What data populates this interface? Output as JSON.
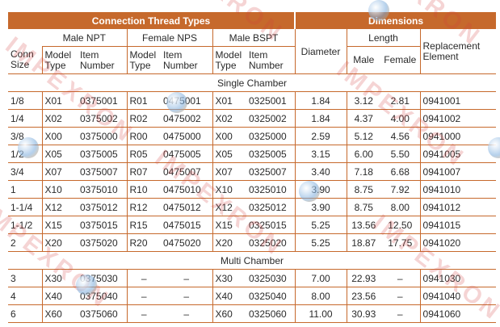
{
  "header": {
    "connection": "Connection Thread Types",
    "dimensions": "Dimensions"
  },
  "groups": {
    "male_npt": "Male NPT",
    "female_nps": "Female NPS",
    "male_bspt": "Male BSPT",
    "length": "Length"
  },
  "columns": {
    "conn_size": "Conn Size",
    "model_type": "Model Type",
    "item_number": "Item Number",
    "diameter": "Diameter",
    "male": "Male",
    "female": "Female",
    "replacement": "Replacement Element"
  },
  "sections": [
    {
      "title": "Single Chamber",
      "rows": [
        [
          "1/8",
          "X01",
          "0375001",
          "R01",
          "0475001",
          "X01",
          "0325001",
          "1.84",
          "3.12",
          "2.81",
          "0941001"
        ],
        [
          "1/4",
          "X02",
          "0375002",
          "R02",
          "0475002",
          "X02",
          "0325002",
          "1.84",
          "4.37",
          "4.00",
          "0941002"
        ],
        [
          "3/8",
          "X00",
          "0375000",
          "R00",
          "0475000",
          "X00",
          "0325000",
          "2.59",
          "5.12",
          "4.56",
          "0941000"
        ],
        [
          "1/2",
          "X05",
          "0375005",
          "R05",
          "0475005",
          "X05",
          "0325005",
          "3.15",
          "6.00",
          "5.50",
          "0941005"
        ],
        [
          "3/4",
          "X07",
          "0375007",
          "R07",
          "0475007",
          "X07",
          "0325007",
          "3.40",
          "7.18",
          "6.68",
          "0941007"
        ],
        [
          "1",
          "X10",
          "0375010",
          "R10",
          "0475010",
          "X10",
          "0325010",
          "3.90",
          "8.75",
          "7.92",
          "0941010"
        ],
        [
          "1-1/4",
          "X12",
          "0375012",
          "R12",
          "0475012",
          "X12",
          "0325012",
          "3.90",
          "8.75",
          "8.00",
          "0941012"
        ],
        [
          "1-1/2",
          "X15",
          "0375015",
          "R15",
          "0475015",
          "X15",
          "0325015",
          "5.25",
          "13.56",
          "12.50",
          "0941015"
        ],
        [
          "2",
          "X20",
          "0375020",
          "R20",
          "0475020",
          "X20",
          "0325020",
          "5.25",
          "18.87",
          "17.75",
          "0941020"
        ]
      ]
    },
    {
      "title": "Multi Chamber",
      "rows": [
        [
          "3",
          "X30",
          "0375030",
          "–",
          "–",
          "X30",
          "0325030",
          "7.00",
          "22.93",
          "–",
          "0941030"
        ],
        [
          "4",
          "X40",
          "0375040",
          "–",
          "–",
          "X40",
          "0325040",
          "8.00",
          "23.56",
          "–",
          "0941040"
        ],
        [
          "6",
          "X60",
          "0375060",
          "–",
          "–",
          "X60",
          "0325060",
          "11.00",
          "30.93",
          "–",
          "0941060"
        ]
      ]
    }
  ],
  "watermark": {
    "text": "IMPEXRON"
  },
  "colors": {
    "accent": "#c6692c",
    "header_text": "#ffffff",
    "body_text": "#2a2a2a"
  }
}
